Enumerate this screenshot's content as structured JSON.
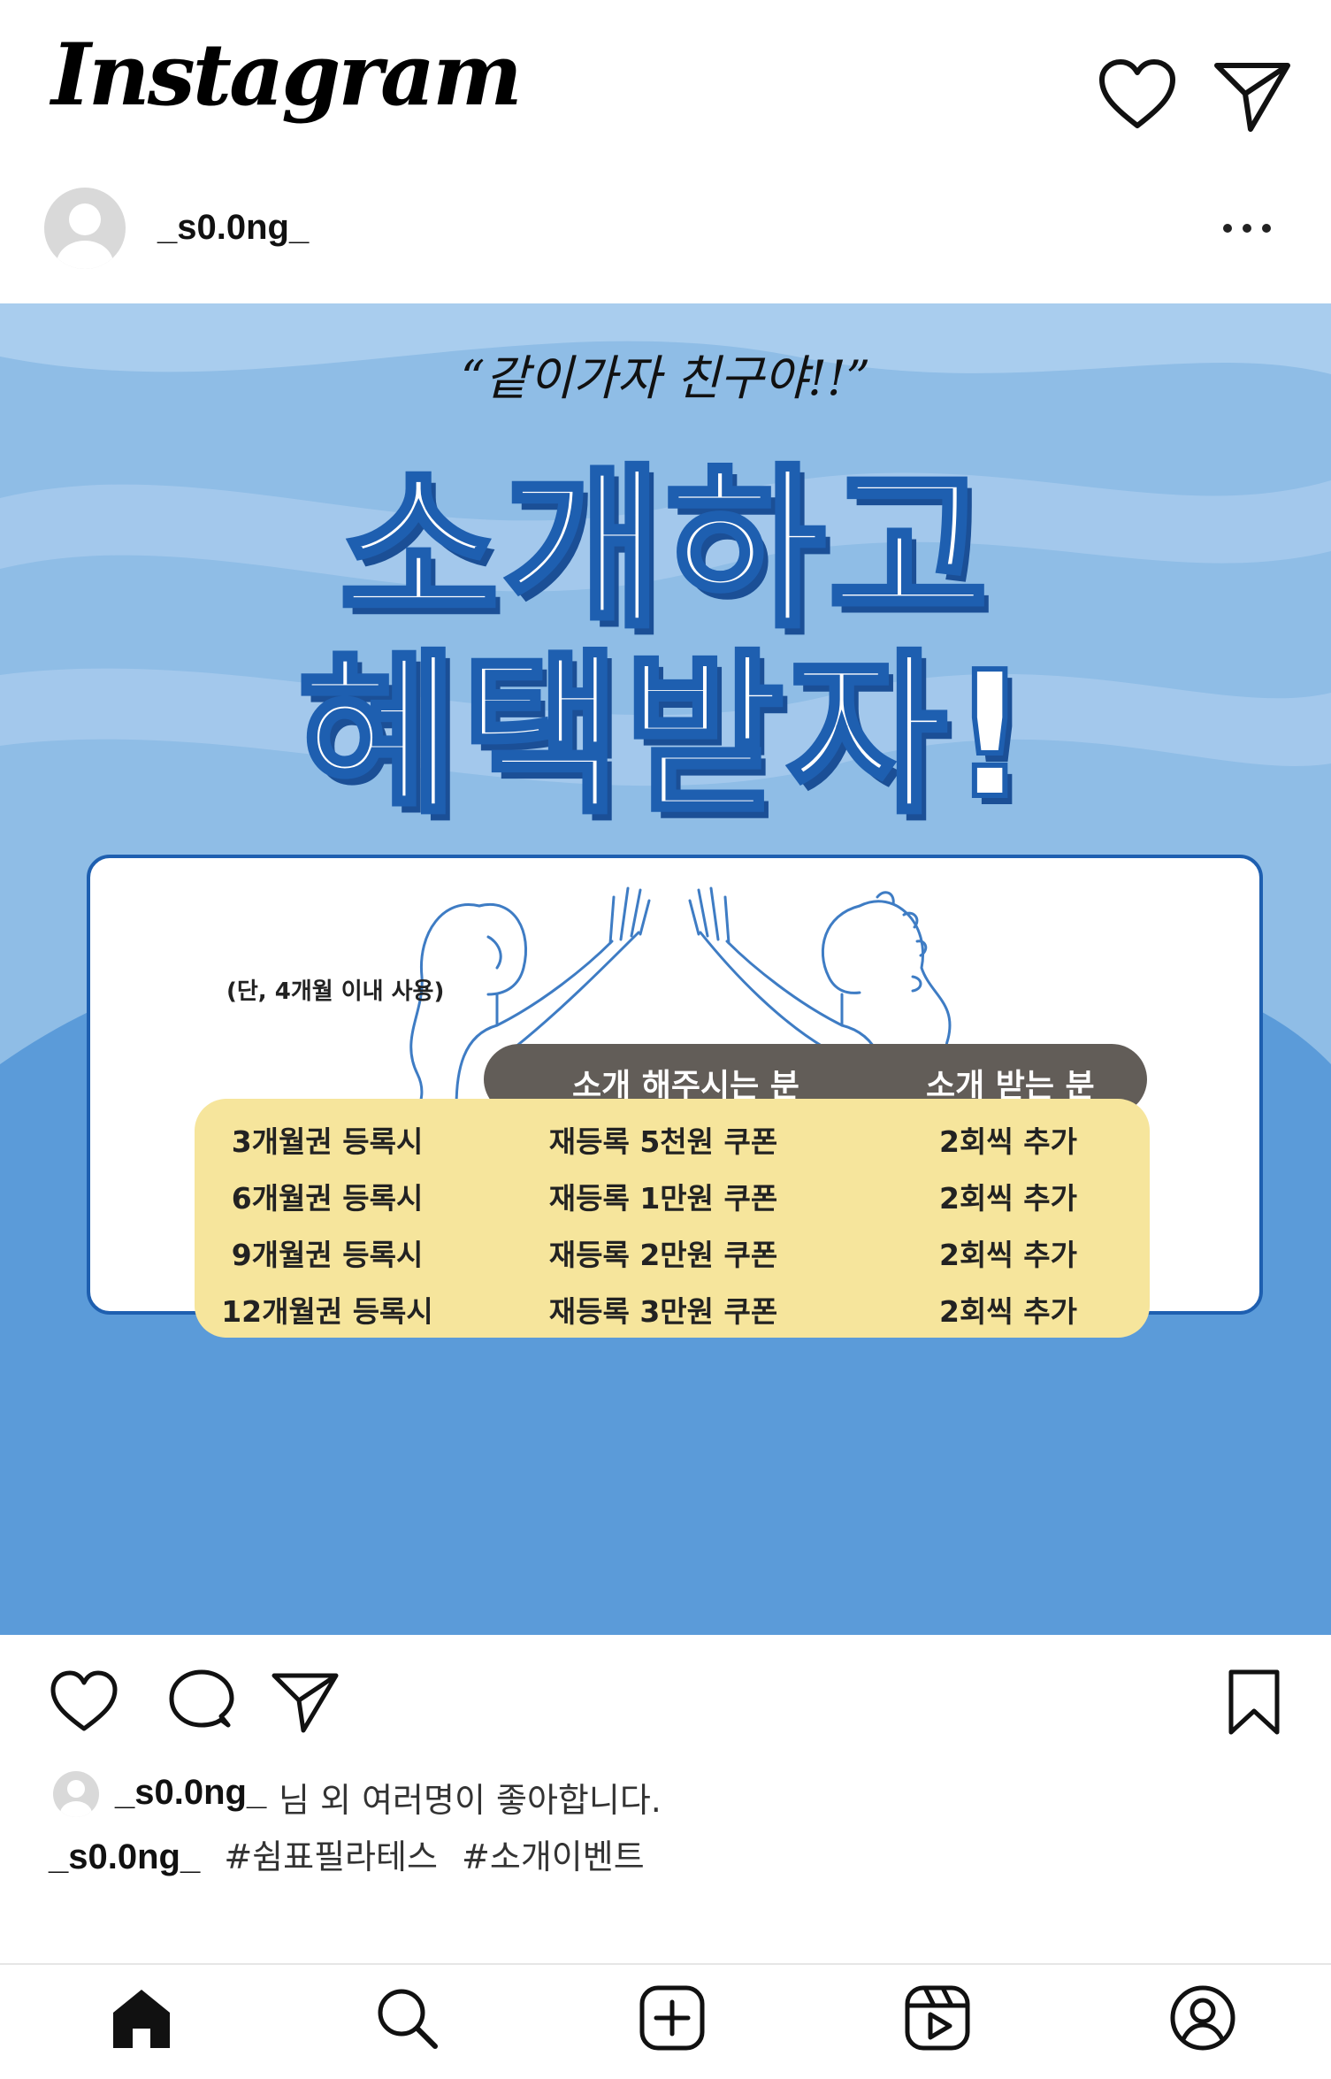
{
  "app": {
    "brand": "Instagram"
  },
  "post": {
    "username": "_s0.0ng_",
    "image": {
      "quote": "“같이가자 친구야!!”",
      "headline_line1": "소개하고",
      "headline_line2": "혜택받자!",
      "table": {
        "col2_header": "소개 해주시는 분",
        "col3_header": "소개 받는 분",
        "rows": [
          {
            "plan": "3개월권 등록시",
            "referrer": "재등록 5천원 쿠폰",
            "referee": "2회씩 추가"
          },
          {
            "plan": "6개월권 등록시",
            "referrer": "재등록 1만원 쿠폰",
            "referee": "2회씩 추가"
          },
          {
            "plan": "9개월권 등록시",
            "referrer": "재등록 2만원 쿠폰",
            "referee": "2회씩 추가"
          },
          {
            "plan": "12개월권 등록시",
            "referrer": "재등록 3만원 쿠폰",
            "referee": "2회씩 추가"
          }
        ],
        "footnote": "(단, 4개월 이내 사용)"
      }
    },
    "likes": {
      "user": "_s0.0ng_",
      "rest": "님 외 여러명이 좋아합니다."
    },
    "caption": {
      "user": "_s0.0ng_",
      "hashtags": [
        "#쉼표필라테스",
        "#소개이벤트"
      ]
    }
  },
  "icons": {
    "top": [
      "heart-icon",
      "send-icon"
    ],
    "actions": [
      "like-icon",
      "comment-icon",
      "share-icon",
      "bookmark-icon"
    ],
    "nav": [
      "home-icon",
      "search-icon",
      "create-icon",
      "reels-icon",
      "profile-icon"
    ]
  },
  "colors": {
    "image_background": "#8fbde6",
    "headline_outline": "#1e5fb0",
    "table_header": "#625d58",
    "table_body": "#f6e59c"
  }
}
